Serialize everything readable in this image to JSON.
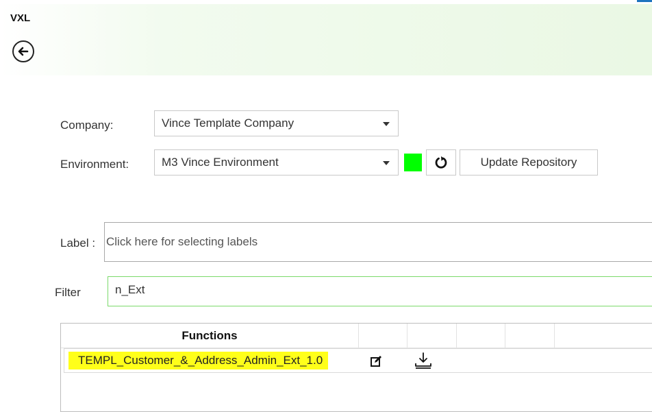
{
  "app": {
    "title": "VXL"
  },
  "form": {
    "company_label": "Company:",
    "company_value": "Vince Template Company",
    "environment_label": "Environment:",
    "environment_value": "M3 Vince Environment",
    "environment_status_color": "#00ff00",
    "update_button": "Update Repository",
    "label_label": "Label :",
    "label_placeholder": "Click here for selecting labels",
    "filter_label": "Filter",
    "filter_value": "n_Ext"
  },
  "grid": {
    "header": "Functions",
    "rows": [
      {
        "name": "TEMPL_Customer_&_Address_Admin_Ext_1.0",
        "highlight_color": "#ffff1a"
      }
    ]
  },
  "icons": {
    "back": "arrow-left-circle-icon",
    "refresh": "refresh-icon",
    "edit": "edit-icon",
    "download": "download-icon"
  }
}
